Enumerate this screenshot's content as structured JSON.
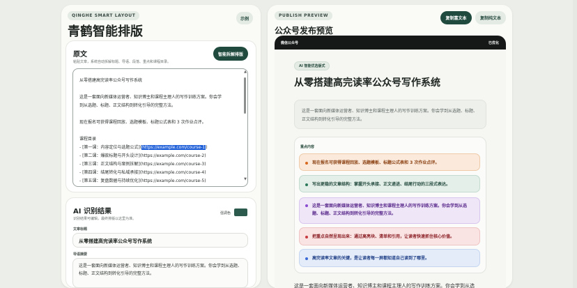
{
  "header": {
    "eyebrow": "QINGHE SMART LAYOUT",
    "demo_button": "示例",
    "app_title": "青鹤智能排版"
  },
  "source": {
    "title": "原文",
    "hint": "粘贴文章，系统自动拆解标题、导语、段落、重点和课程目录。",
    "smart_button": "智能拆解排版",
    "lines": [
      "从零搭建高完读率公众号写作系统",
      "",
      "这是一套面向新媒体运营者、知识博主和课程主理人的写作训练方案。你会学",
      "到从选题、标题、正文结构到转化引导的完整方法。",
      "",
      "现在报名可获得课程回放、选题模板、标题公式表和 3 次作业点评。",
      "",
      "课程目录",
      "- [第一课：内容定位与选题公式](",
      "- [第二课：爆款标题与开头设计](https://example.com/course-2)",
      "- [第三课：正文结构与案例拆解](https://example.com/course-3)",
      "- [第四课：结尾转化与私域承接](https://example.com/course-4)",
      "- [第五课：复盘数据与持续优化](https://example.com/course-5)"
    ],
    "selected_text": "https://example.com/course-1",
    "after_selection": ")"
  },
  "ai": {
    "title": "AI 识别结果",
    "hint": "识别结果可编辑，最终排版以这里为准。",
    "color_label": "强调色",
    "accent_color": "#2c5a4c",
    "title_label": "文章标题",
    "title_value": "从零搭建高完读率公众号写作系统",
    "summary_label": "导语摘要",
    "summary_value": "这是一套面向新媒体运营者、知识博主和课程主理人的写作训练方案。你会学到从选题、标题、正文结构到转化引导的完整方法。"
  },
  "preview": {
    "eyebrow": "PUBLISH PREVIEW",
    "title": "公众号发布预览",
    "copy_rich_button": "复制富文本",
    "copy_plain_button": "复制纯文本",
    "bar_left": "微信公众号",
    "bar_right": "已优化",
    "tag": "AI 智能优选版式",
    "article_title": "从零搭建高完读率公众号写作系统",
    "summary": "这是一套面向新媒体运营者、知识博主和课程主理人的写作训练方案。你会学到从选题、标题、正文结构到转化引导的完整方法。",
    "keypoints_title": "重点内容",
    "keypoints": [
      {
        "text": "现在报名可获得课程回放、选题模板、标题公式表和 3 次作业点评。",
        "bg": "#fbeadc",
        "border": "#eecaa8",
        "color": "#8a3f10",
        "dot": "#d86a1f"
      },
      {
        "text": "写出更稳的文章结构：掌握开头承接、正文递进、结尾行动的三段式表达。",
        "bg": "#e4efe9",
        "border": "#c3dccf",
        "color": "#234a3e",
        "dot": "#2c7a5c"
      },
      {
        "text": "这是一套面向新媒体运营者、知识博主和课程主理人的写作训练方案。你会学到从选题、标题、正文结构到转化引导的完整方法。",
        "bg": "#efe6f7",
        "border": "#d9c6ee",
        "color": "#5a2a8c",
        "dot": "#8a4cd0"
      },
      {
        "text": "把重点自然呈现出来：通过高亮块、清单和引用，让读者快速抓住核心价值。",
        "bg": "#fae3e3",
        "border": "#eec3c3",
        "color": "#8a1f24",
        "dot": "#c73a3f"
      },
      {
        "text": "高完读率文章的关键，是让读者每一屏都知道自己读到了哪里。",
        "bg": "#e4ecfa",
        "border": "#c5d5f0",
        "color": "#1f3f86",
        "dot": "#3a6ad6"
      }
    ],
    "bottom_text": "这是一套面向新媒体运营者、知识博主和课程主理人的写作训练方案。你会学到从选"
  }
}
